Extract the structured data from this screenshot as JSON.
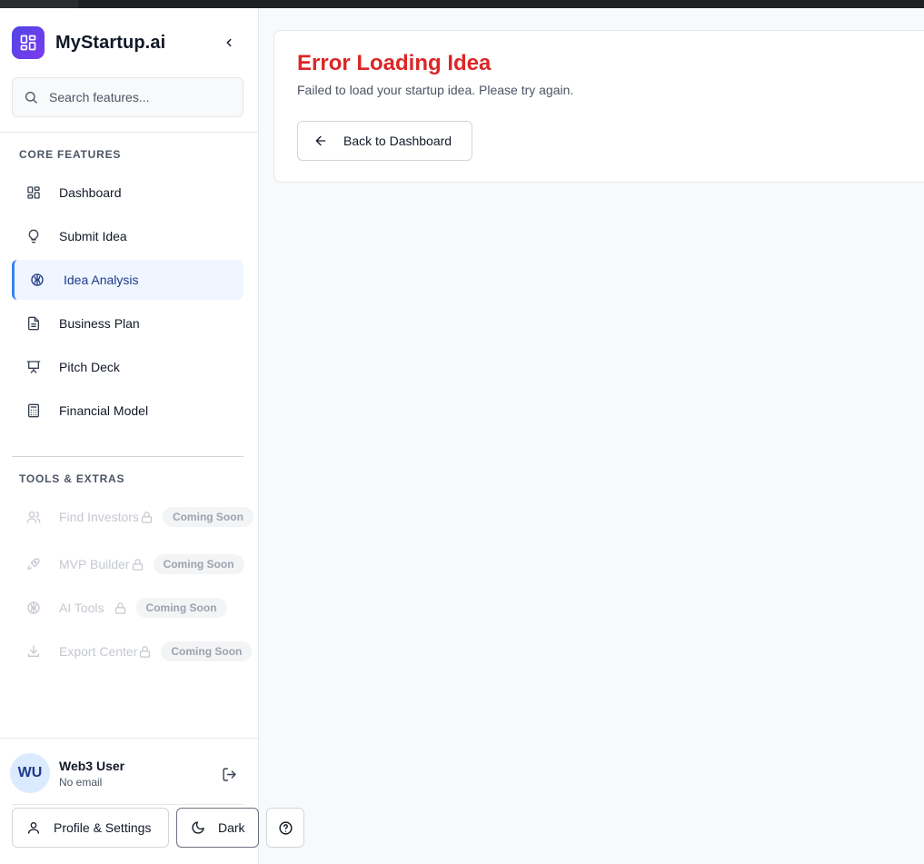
{
  "brand": {
    "name": "MyStartup.ai"
  },
  "search": {
    "placeholder": "Search features..."
  },
  "sections": {
    "core": "CORE FEATURES",
    "tools": "TOOLS & EXTRAS"
  },
  "core_items": [
    {
      "label": "Dashboard",
      "icon": "dashboard-icon"
    },
    {
      "label": "Submit Idea",
      "icon": "lightbulb-icon"
    },
    {
      "label": "Idea Analysis",
      "icon": "brain-icon",
      "active": true
    },
    {
      "label": "Business Plan",
      "icon": "document-icon"
    },
    {
      "label": "Pitch Deck",
      "icon": "presentation-icon"
    },
    {
      "label": "Financial Model",
      "icon": "calculator-icon"
    }
  ],
  "tool_items": [
    {
      "label": "Find Investors",
      "badge": "Coming Soon",
      "icon": "users-icon"
    },
    {
      "label": "MVP Builder",
      "badge": "Coming Soon",
      "icon": "rocket-icon"
    },
    {
      "label": "AI Tools",
      "badge": "Coming Soon",
      "icon": "brain-icon"
    },
    {
      "label": "Export Center",
      "badge": "Coming Soon",
      "icon": "download-icon"
    }
  ],
  "user": {
    "initials": "WU",
    "name": "Web3 User",
    "email": "No email"
  },
  "footer": {
    "profile_label": "Profile & Settings",
    "theme_label": "Dark"
  },
  "error_card": {
    "title": "Error Loading Idea",
    "message": "Failed to load your startup idea. Please try again.",
    "back_label": "Back to Dashboard"
  },
  "colors": {
    "accent": "#3b82f6",
    "active_bg": "#eff6ff",
    "error": "#dc2626",
    "logo_gradient_start": "#4f46e5",
    "logo_gradient_end": "#7c3aed"
  }
}
